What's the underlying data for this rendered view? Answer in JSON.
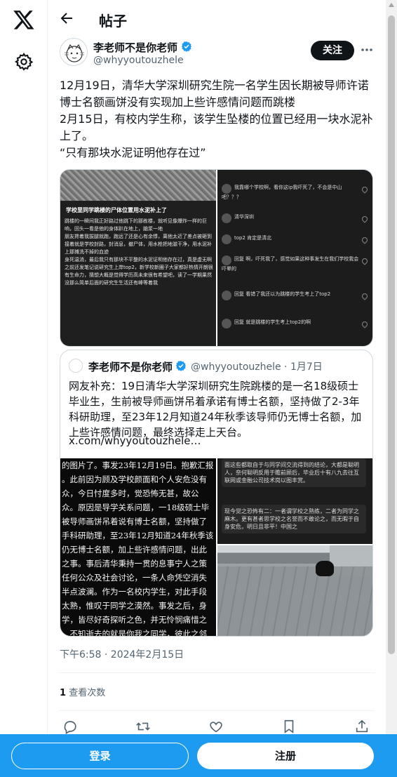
{
  "topbar": {
    "title": "帖子"
  },
  "author": {
    "name": "李老师不是你老师",
    "handle": "@whyyoutouzhele"
  },
  "follow_label": "关注",
  "tweet": {
    "text": "12月19日，清华大学深圳研究生院一名学生因长期被导师许诺博士名额画饼没有实现加上些许感情问题而跳楼\n2月15日，有校内学生称，该学生坠楼的位置已经用一块水泥补上了。\n“只有那块水泥证明他存在过”"
  },
  "media1": {
    "title": "学校里同学跳楼的尸体位置用水泥补上了",
    "body": "跳楼的一瞬间我正好路过他跳下的那栋楼，就听见像爆炸一样的巨响，回头一看是他的身体趴在地上，脑浆一地\n朋友搀着我拔腿就跑，跑远了还是心有余悸，离他太近了差点被砸到\n接着就是学校封路，封消息，撤尸体，用水枪把地滋干净，用水泥补上那摊洗不掉的血迹\n身死温消，最后我只有那块不平整的水泥证明他存在过，真是虚无啊\n之前还发笔记说研究生上岸top2，新学校新圈子大家都好热情开朗很有生命力，猜想大概是觉得学历高未来很有希望吧，读了一学期果然没那么简单后面的研究生生活还有峰等着我"
  },
  "media2": {
    "comments": [
      "我靠哪个学校啊，看你这ip我吓死了，不会是中山吧？？？",
      "清华深圳",
      "top2 肯定是清北",
      "回复 啊，吓死我了，感觉如果这种事发生在我们学校我会吓晕的",
      "回复 看错了我还以为跳楼的学生考上了top2",
      "回复 就是跳楼的学生考上top2的啊"
    ]
  },
  "quote": {
    "name": "李老师不是你老师",
    "handle": "@whyyoutouzhele · 1月7日",
    "text": "网友补充：19日清华大学深圳研究生院跳楼的是一名18级硕士毕业生，生前被导师画饼吊着承诺有博士名额，坚持做了2-3年科研助理，至23年12月知道24年秋季该导师仍无博士名额，加上些许感情问题，最终选择走上天台。",
    "link": "x.com/whyyoutouzhele…",
    "img_text": "的图片了。事发23年12月19日。抱歉汇报\n。此前因为顾及学校颜面和个人安危没有\n众，今日忖度多时，觉恐怖无甚，故公\n众。原因是导学关系问题，一18级硕士毕\n被导师画饼吊着说有博士名额，坚持做了\n手科研助理，至23年12月知道24年秋季该\n仍无博士名额，加上些许感情问题，出此\n之事。事后清华秉持一贯的息事宁人之策\n任何公众及社会讨论，一条人命凭空消失\n半点波澜。作为一名校内学生，对此手段\n太熟，惟叹于同学之漠然。事发之后，身\n学，皆尽好奇探听之色，并无怜悯痛惜之\n，不知逝去的就是你我之同学，彼此之邻\n，更是无一人敢于众出问，试讨公道。由\n中国顶尖学子之麻木漠然之甚矣！",
    "img_rt_a": "面这些都取自于与同学间交流得到的结论，大都是聪明人，奈何聪明反用于瞻前顾后，毕业后十有八九去往互联网或金融公司技术岗以图丰赏。",
    "img_rt_b": "现今觉之恐怖有二：一者谓学校之熟练，二者为同学之麻木。更有甚者思学校之名誉而不敢论之，而无暇于自身安危，明日且非平！中国之"
  },
  "timestamp": "下午6:58 · 2024年2月15日",
  "views": {
    "count": "1",
    "label": "查看次数"
  },
  "bottombar": {
    "login": "登录",
    "signup": "注册"
  }
}
